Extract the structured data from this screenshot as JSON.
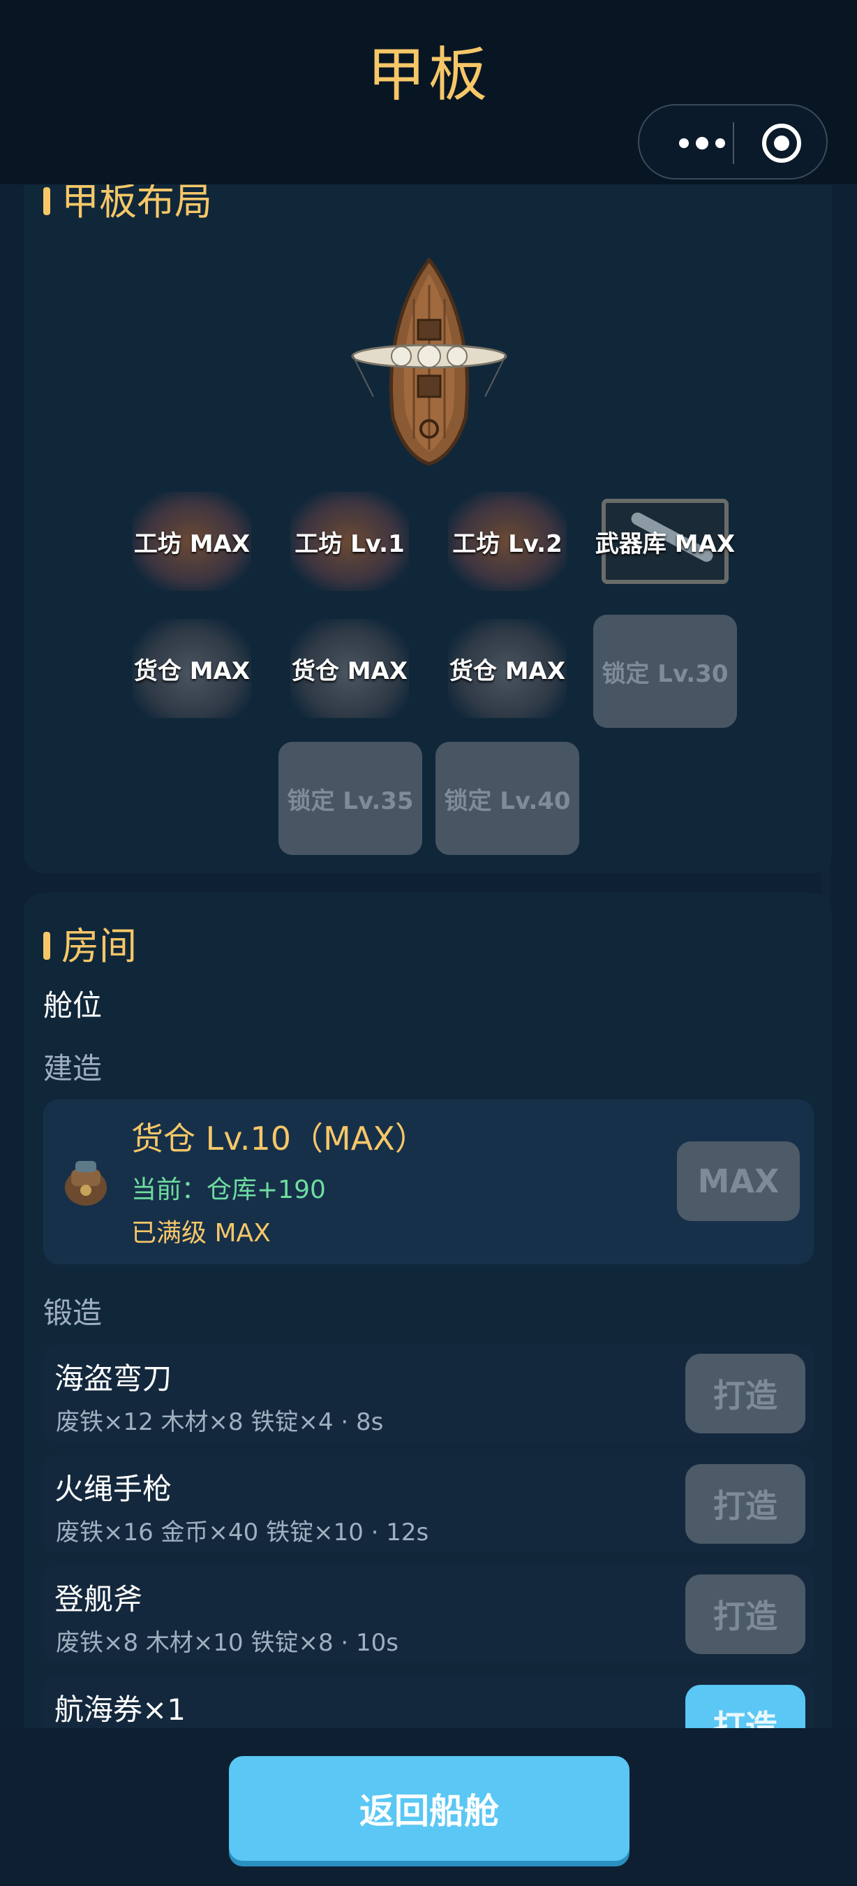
{
  "header": {
    "title": "甲板"
  },
  "deck": {
    "section_title": "甲板布局",
    "slots_row1": [
      "工坊 MAX",
      "工坊 Lv.1",
      "工坊 Lv.2",
      "武器库 MAX"
    ],
    "slots_row2": [
      "货仓 MAX",
      "货仓 MAX",
      "货仓 MAX",
      "锁定 Lv.30"
    ],
    "slots_row3": [
      "锁定 Lv.35",
      "锁定 Lv.40"
    ]
  },
  "room": {
    "section_title": "房间",
    "cabin_label": "舱位",
    "build_label": "建造",
    "build": {
      "name": "货仓  Lv.10（MAX）",
      "current": "当前：仓库+190",
      "status": "已满级 MAX",
      "button": "MAX"
    },
    "forge_label": "锻造",
    "forge_items": [
      {
        "name": "海盗弯刀",
        "cost": "废铁×12  木材×8  铁锭×4 · 8s",
        "button": "打造"
      },
      {
        "name": "火绳手枪",
        "cost": "废铁×16  金币×40  铁锭×10 · 12s",
        "button": "打造"
      },
      {
        "name": "登舰斧",
        "cost": "废铁×8  木材×10  铁锭×8 · 10s",
        "button": "打造"
      },
      {
        "name": "航海券×1",
        "cost": "",
        "button": "打造"
      }
    ]
  },
  "footer": {
    "back_button": "返回船舱"
  }
}
